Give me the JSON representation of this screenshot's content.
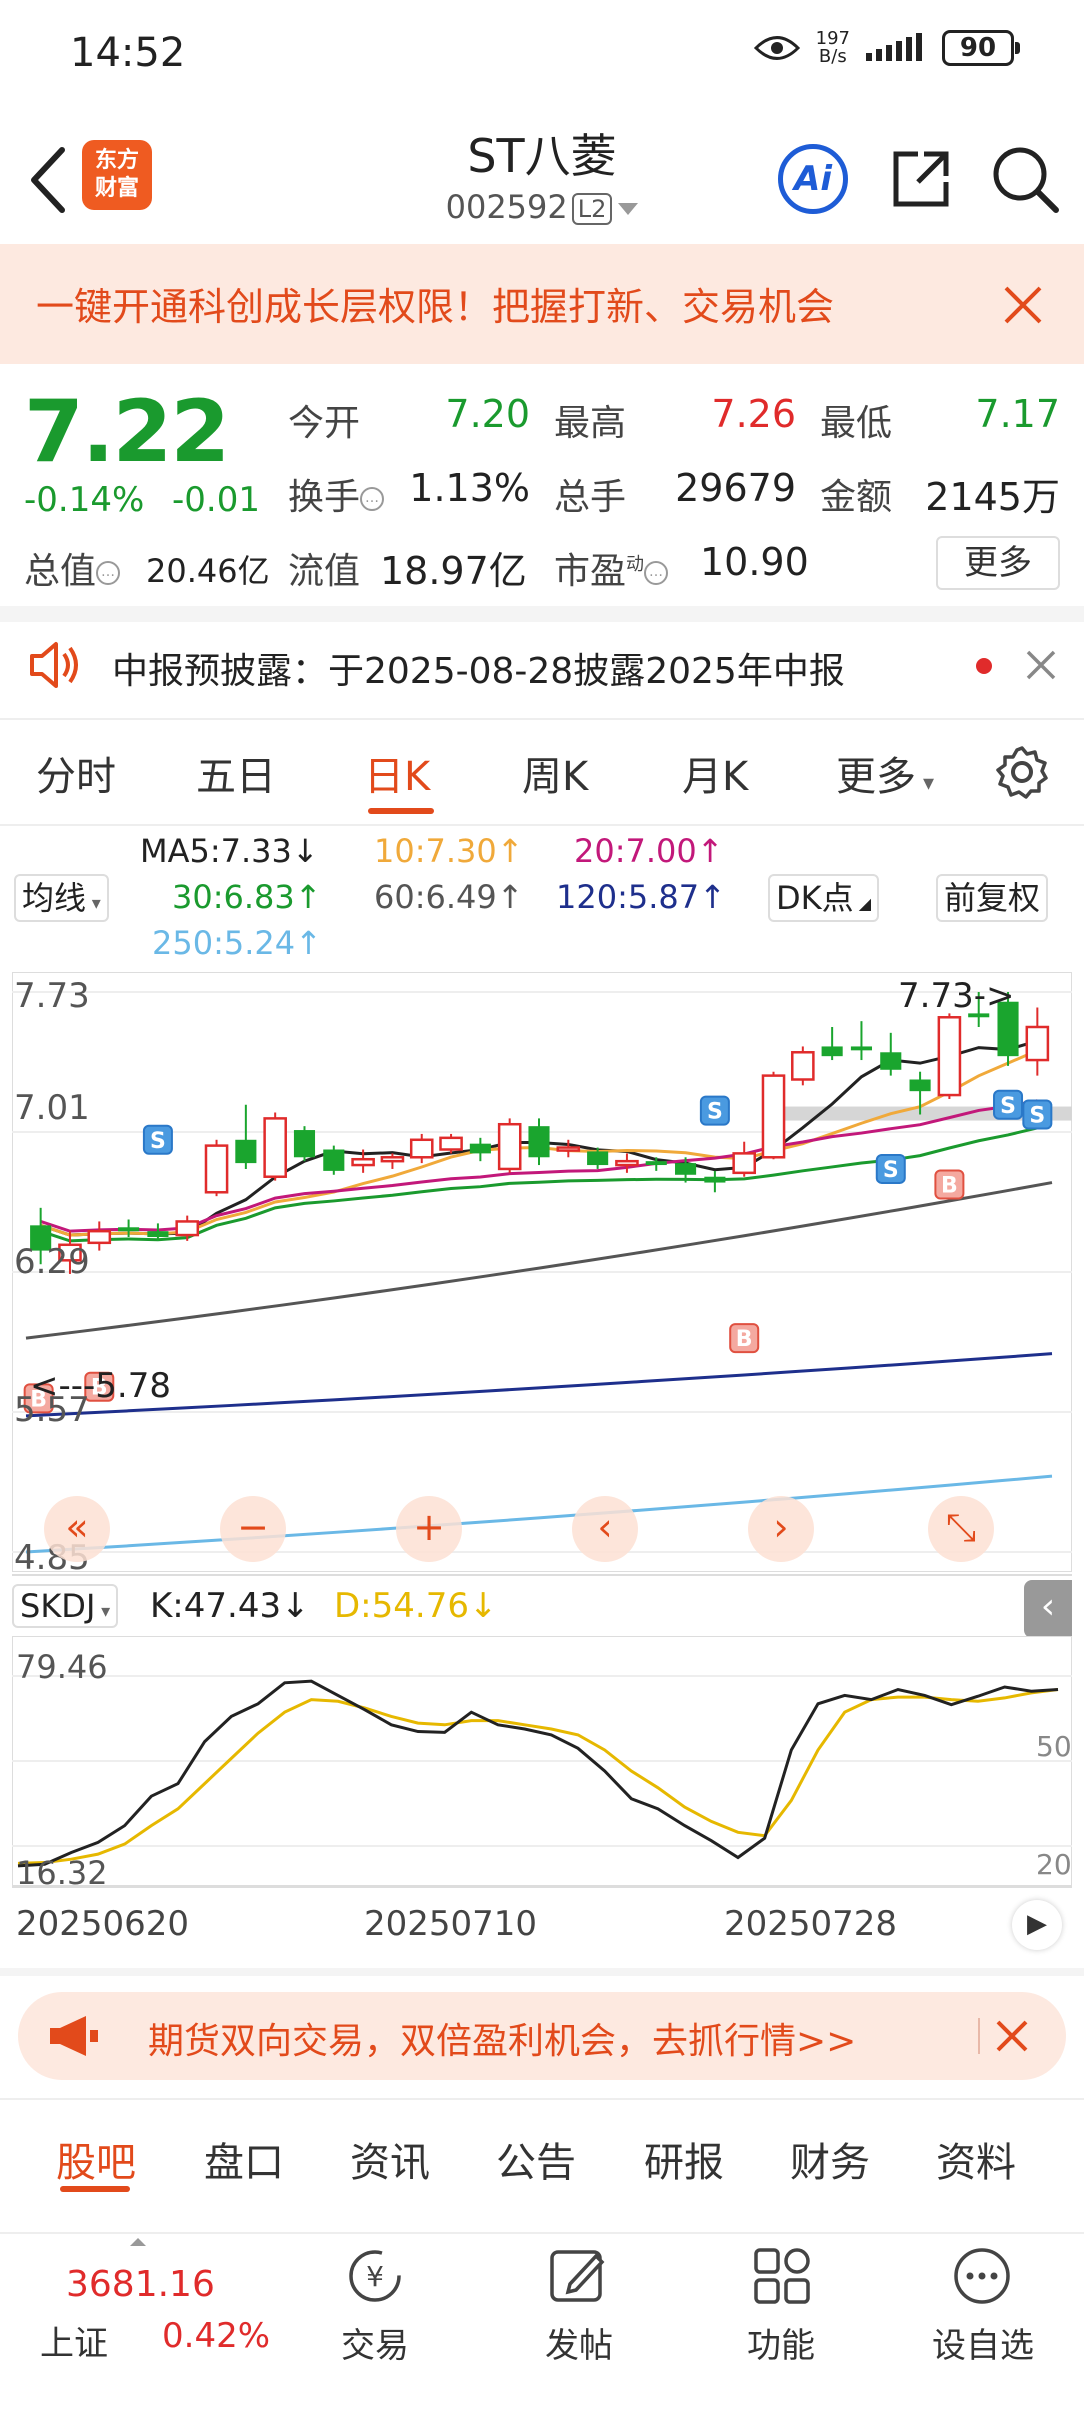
{
  "status": {
    "time": "14:52",
    "netspeed_value": "197",
    "netspeed_unit": "B/s",
    "battery": "90"
  },
  "header": {
    "logo_line1": "东方",
    "logo_line2": "财富",
    "name": "ST八菱",
    "code": "002592",
    "level": "L2",
    "ai": "Ai"
  },
  "promo": {
    "text": "一键开通科创成长层权限！把握打新、交易机会"
  },
  "quote": {
    "price": "7.22",
    "change_pct": "-0.14%",
    "change_amt": "-0.01",
    "open_label": "今开",
    "open": "7.20",
    "high_label": "最高",
    "high": "7.26",
    "low_label": "最低",
    "low": "7.17",
    "turnover_label": "换手",
    "turnover": "1.13%",
    "volume_label": "总手",
    "volume": "29679",
    "amount_label": "金额",
    "amount": "2145万",
    "mcap_label": "总值",
    "mcap": "20.46亿",
    "float_label": "流值",
    "float": "18.97亿",
    "pe_label": "市盈",
    "pe_sup": "动",
    "pe": "10.90",
    "more": "更多"
  },
  "notice": {
    "text": "中报预披露：于2025-08-28披露2025年中报"
  },
  "tabs": [
    "分时",
    "五日",
    "日K",
    "周K",
    "月K",
    "更多"
  ],
  "ma": {
    "selector": "均线",
    "ma5": "MA5:7.33↓",
    "ma10": "10:7.30↑",
    "ma20": "20:7.00↑",
    "ma30": "30:6.83↑",
    "ma60": "60:6.49↑",
    "ma120": "120:5.87↑",
    "ma250": "250:5.24↑",
    "dk": "DK点",
    "adjust": "前复权",
    "colors": {
      "ma5": "#222222",
      "ma10": "#f0a93a",
      "ma20": "#c2187a",
      "ma30": "#1a9a2e",
      "ma60": "#555555",
      "ma120": "#1e2f8c",
      "ma250": "#6ab8e6"
    }
  },
  "chart_data": {
    "type": "candlestick",
    "y_ticks": [
      "7.73",
      "7.01",
      "6.29",
      "5.57",
      "4.85"
    ],
    "ylim": [
      4.85,
      7.73
    ],
    "high_marker": "7.73->",
    "low_marker": "<---5.78",
    "candles": [
      {
        "o": 6.4,
        "c": 6.53,
        "h": 6.62,
        "l": 6.33,
        "color": "green"
      },
      {
        "o": 6.35,
        "c": 6.43,
        "h": 6.5,
        "l": 6.28,
        "color": "red"
      },
      {
        "o": 6.44,
        "c": 6.5,
        "h": 6.55,
        "l": 6.4,
        "color": "red"
      },
      {
        "o": 6.52,
        "c": 6.5,
        "h": 6.56,
        "l": 6.47,
        "color": "green"
      },
      {
        "o": 6.5,
        "c": 6.47,
        "h": 6.54,
        "l": 6.45,
        "color": "green"
      },
      {
        "o": 6.48,
        "c": 6.55,
        "h": 6.58,
        "l": 6.45,
        "color": "red"
      },
      {
        "o": 6.7,
        "c": 6.94,
        "h": 6.97,
        "l": 6.68,
        "color": "red"
      },
      {
        "o": 6.97,
        "c": 6.85,
        "h": 7.15,
        "l": 6.82,
        "color": "green"
      },
      {
        "o": 6.78,
        "c": 7.08,
        "h": 7.11,
        "l": 6.76,
        "color": "red"
      },
      {
        "o": 7.02,
        "c": 6.88,
        "h": 7.04,
        "l": 6.86,
        "color": "green"
      },
      {
        "o": 6.92,
        "c": 6.81,
        "h": 6.94,
        "l": 6.79,
        "color": "green"
      },
      {
        "o": 6.84,
        "c": 6.87,
        "h": 6.92,
        "l": 6.8,
        "color": "red"
      },
      {
        "o": 6.86,
        "c": 6.88,
        "h": 6.9,
        "l": 6.82,
        "color": "red"
      },
      {
        "o": 6.88,
        "c": 6.97,
        "h": 7.0,
        "l": 6.85,
        "color": "red"
      },
      {
        "o": 6.92,
        "c": 6.98,
        "h": 7.0,
        "l": 6.9,
        "color": "red"
      },
      {
        "o": 6.95,
        "c": 6.9,
        "h": 6.98,
        "l": 6.86,
        "color": "green"
      },
      {
        "o": 6.82,
        "c": 7.05,
        "h": 7.08,
        "l": 6.8,
        "color": "red"
      },
      {
        "o": 7.04,
        "c": 6.88,
        "h": 7.08,
        "l": 6.84,
        "color": "green"
      },
      {
        "o": 6.93,
        "c": 6.92,
        "h": 6.97,
        "l": 6.88,
        "color": "red"
      },
      {
        "o": 6.91,
        "c": 6.84,
        "h": 6.93,
        "l": 6.82,
        "color": "green"
      },
      {
        "o": 6.84,
        "c": 6.86,
        "h": 6.9,
        "l": 6.8,
        "color": "red"
      },
      {
        "o": 6.86,
        "c": 6.84,
        "h": 6.88,
        "l": 6.81,
        "color": "green"
      },
      {
        "o": 6.85,
        "c": 6.79,
        "h": 6.88,
        "l": 6.75,
        "color": "green"
      },
      {
        "o": 6.78,
        "c": 6.75,
        "h": 6.81,
        "l": 6.7,
        "color": "green"
      },
      {
        "o": 6.8,
        "c": 6.9,
        "h": 6.96,
        "l": 6.78,
        "color": "red"
      },
      {
        "o": 6.88,
        "c": 7.3,
        "h": 7.32,
        "l": 6.87,
        "color": "red"
      },
      {
        "o": 7.28,
        "c": 7.42,
        "h": 7.45,
        "l": 7.25,
        "color": "red"
      },
      {
        "o": 7.45,
        "c": 7.4,
        "h": 7.55,
        "l": 7.38,
        "color": "green"
      },
      {
        "o": 7.43,
        "c": 7.45,
        "h": 7.58,
        "l": 7.38,
        "color": "green"
      },
      {
        "o": 7.42,
        "c": 7.33,
        "h": 7.52,
        "l": 7.3,
        "color": "green"
      },
      {
        "o": 7.28,
        "c": 7.22,
        "h": 7.32,
        "l": 7.1,
        "color": "green"
      },
      {
        "o": 7.2,
        "c": 7.6,
        "h": 7.62,
        "l": 7.18,
        "color": "red"
      },
      {
        "o": 7.6,
        "c": 7.62,
        "h": 7.73,
        "l": 7.55,
        "color": "green"
      },
      {
        "o": 7.68,
        "c": 7.4,
        "h": 7.73,
        "l": 7.35,
        "color": "green"
      },
      {
        "o": 7.38,
        "c": 7.55,
        "h": 7.65,
        "l": 7.3,
        "color": "red"
      }
    ]
  },
  "kdj": {
    "selector": "SKDJ",
    "k": "K:47.43↓",
    "d": "D:54.76↓",
    "y_ticks": [
      "79.46",
      "16.32"
    ],
    "right_ticks": [
      "50",
      "20"
    ]
  },
  "dates": [
    "20250620",
    "20250710",
    "20250728"
  ],
  "bottom_promo": {
    "text": "期货双向交易，双倍盈利机会，去抓行情>>"
  },
  "subtabs": [
    "股吧",
    "盘口",
    "资讯",
    "公告",
    "研报",
    "财务",
    "资料"
  ],
  "bottom_nav": {
    "index_value": "3681.16",
    "index_name": "上证",
    "index_change": "0.42%",
    "items": [
      "交易",
      "发帖",
      "功能",
      "设自选"
    ]
  }
}
